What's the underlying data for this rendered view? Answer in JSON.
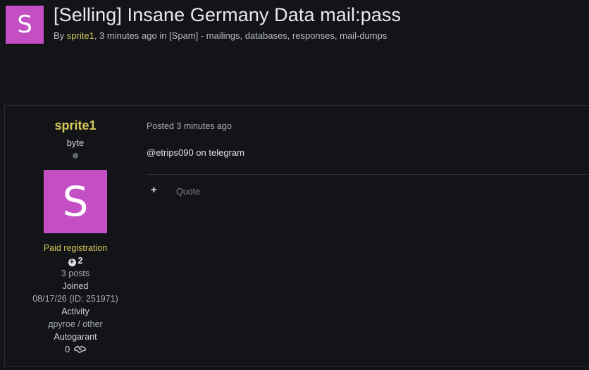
{
  "topic": {
    "avatar_letter": "S",
    "title": "[Selling] Insane Germany Data mail:pass",
    "meta_prefix": "By ",
    "author": "sprite1",
    "meta_suffix": ", 3 minutes ago in [Spam] - mailings, databases, responses, mail-dumps"
  },
  "post": {
    "author": {
      "name": "sprite1",
      "rank": "byte",
      "avatar_letter": "S",
      "group": "Paid registration",
      "reputation": "2",
      "posts": "3 posts",
      "joined_label": "Joined",
      "joined_value": "08/17/26 (ID: 251971)",
      "activity_label": "Activity",
      "activity_value": "другое / other",
      "autogarant_label": "Autogarant",
      "autogarant_value": "0"
    },
    "posted": "Posted 3 minutes ago",
    "content": "@etrips090 on telegram",
    "actions": {
      "plus": "+",
      "quote": "Quote"
    }
  },
  "colors": {
    "background": "#131418",
    "accent_yellow": "#d4c95a",
    "avatar": "#c44fc5"
  }
}
